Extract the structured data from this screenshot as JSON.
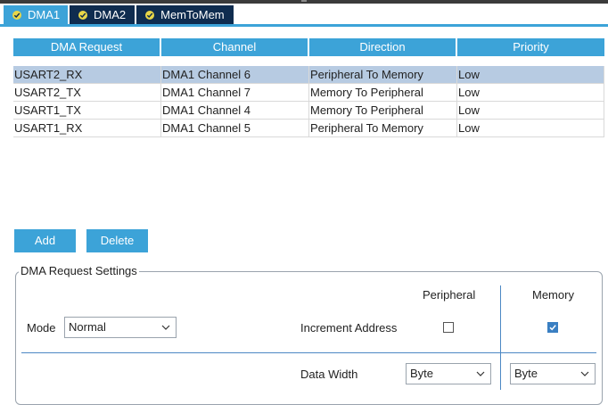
{
  "tabs": [
    {
      "label": "DMA1",
      "status_icon": "check-circle-icon"
    },
    {
      "label": "DMA2",
      "status_icon": "check-circle-icon"
    },
    {
      "label": "MemToMem",
      "status_icon": "check-circle-icon"
    }
  ],
  "table": {
    "headers": [
      "DMA Request",
      "Channel",
      "Direction",
      "Priority"
    ],
    "rows": [
      [
        "USART2_RX",
        "DMA1 Channel 6",
        "Peripheral To Memory",
        "Low"
      ],
      [
        "USART2_TX",
        "DMA1 Channel 7",
        "Memory To Peripheral",
        "Low"
      ],
      [
        "USART1_TX",
        "DMA1 Channel 4",
        "Memory To Peripheral",
        "Low"
      ],
      [
        "USART1_RX",
        "DMA1 Channel 5",
        "Peripheral To Memory",
        "Low"
      ]
    ],
    "selected_row": 0
  },
  "buttons": {
    "add": "Add",
    "delete": "Delete"
  },
  "settings": {
    "title": "DMA Request Settings",
    "mode_label": "Mode",
    "mode_value": "Normal",
    "peripheral_header": "Peripheral",
    "memory_header": "Memory",
    "increment_label": "Increment Address",
    "increment_peripheral": false,
    "increment_memory": true,
    "data_width_label": "Data Width",
    "data_width_peripheral": "Byte",
    "data_width_memory": "Byte"
  },
  "colors": {
    "accent": "#3ca3d8",
    "tab_inactive": "#0f2c4f",
    "selection": "#b7cbe2",
    "status_ok": "#e8d648"
  }
}
